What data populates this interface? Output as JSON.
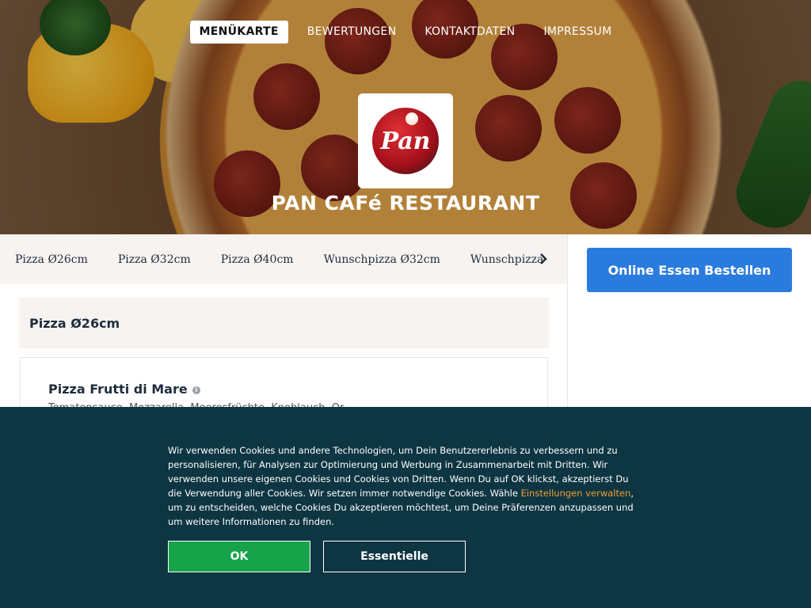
{
  "nav": {
    "items": [
      {
        "label": "MENÜKARTE",
        "active": true
      },
      {
        "label": "BEWERTUNGEN",
        "active": false
      },
      {
        "label": "KONTAKTDATEN",
        "active": false
      },
      {
        "label": "IMPRESSUM",
        "active": false
      }
    ]
  },
  "restaurant": {
    "name": "PAN CAFé RESTAURANT",
    "logo_text": "Pan"
  },
  "categories": {
    "items": [
      "Pizza Ø26cm",
      "Pizza Ø32cm",
      "Pizza Ø40cm",
      "Wunschpizza Ø32cm",
      "Wunschpizza"
    ],
    "next_icon": "chevron-right-icon"
  },
  "order": {
    "button_label": "Online Essen Bestellen"
  },
  "menu": {
    "section_title": "Pizza Ø26cm",
    "items": [
      {
        "name": "Pizza Frutti di Mare",
        "info_icon": "info-icon",
        "description_partial": "Tomatensauce, Mozzarella, Meeresfrüchte, Knoblauch, Or..."
      }
    ]
  },
  "cookie_banner": {
    "text_before_link": "Wir verwenden Cookies und andere Technologien, um Dein Benutzererlebnis zu verbessern und zu personalisieren, für Analysen zur Optimierung und Werbung in Zusammenarbeit mit Dritten. Wir verwenden unsere eigenen Cookies und Cookies von Dritten. Wenn Du auf OK klickst, akzeptierst Du die Verwendung aller Cookies. Wir setzen immer notwendige Cookies. Wähle ",
    "link_text": "Einstellungen verwalten",
    "text_after_link": ", um zu entscheiden, welche Cookies Du akzeptieren möchtest, um Deine Präferenzen anzupassen und um weitere Informationen zu finden.",
    "ok_label": "OK",
    "essential_label": "Essentielle"
  },
  "colors": {
    "order_button": "#2a7bde",
    "cookie_bg": "#0e3642",
    "ok_button": "#16a34a",
    "link": "#f39c34",
    "category_bar": "#f6f3f0"
  }
}
